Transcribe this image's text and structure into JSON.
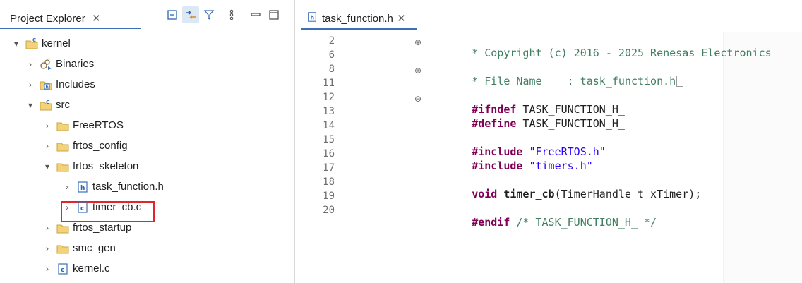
{
  "explorer": {
    "tab_label": "Project Explorer",
    "toolbar_icons": [
      "collapse-all-icon",
      "link-with-editor-icon",
      "filter-icon",
      "view-menu-icon",
      "minimize-icon",
      "maximize-icon"
    ],
    "tree": [
      {
        "label": "kernel",
        "icon": "c-project-icon",
        "expanded": true,
        "level": 0
      },
      {
        "label": "Binaries",
        "icon": "binaries-icon",
        "expanded": false,
        "level": 1
      },
      {
        "label": "Includes",
        "icon": "includes-icon",
        "expanded": false,
        "level": 1
      },
      {
        "label": "src",
        "icon": "source-folder-icon",
        "expanded": true,
        "level": 1
      },
      {
        "label": "FreeRTOS",
        "icon": "folder-icon",
        "expanded": false,
        "level": 2
      },
      {
        "label": "frtos_config",
        "icon": "folder-icon",
        "expanded": false,
        "level": 2
      },
      {
        "label": "frtos_skeleton",
        "icon": "folder-icon",
        "expanded": true,
        "level": 2
      },
      {
        "label": "task_function.h",
        "icon": "header-file-icon",
        "expanded": false,
        "level": 3
      },
      {
        "label": "timer_cb.c",
        "icon": "c-file-icon",
        "expanded": false,
        "level": 3,
        "highlighted": true
      },
      {
        "label": "frtos_startup",
        "icon": "folder-icon",
        "expanded": false,
        "level": 2
      },
      {
        "label": "smc_gen",
        "icon": "folder-icon",
        "expanded": false,
        "level": 2
      },
      {
        "label": "kernel.c",
        "icon": "c-file-icon",
        "expanded": false,
        "level": 2
      }
    ]
  },
  "editor": {
    "tab_label": "task_function.h",
    "line_numbers": [
      "2",
      "6",
      "8",
      "11",
      "12",
      "13",
      "14",
      "15",
      "16",
      "17",
      "18",
      "19",
      "20"
    ],
    "lines": {
      "copyright": "* Copyright (c) 2016 - 2025 Renesas Electronics",
      "filename_prefix": "* File Name    : task_function.h",
      "ifndef_kw": "#ifndef",
      "ifndef_rest": " TASK_FUNCTION_H_",
      "define_kw": "#define",
      "define_rest": " TASK_FUNCTION_H_",
      "include1_kw": "#include",
      "include1_str": " \"FreeRTOS.h\"",
      "include2_kw": "#include",
      "include2_str": " \"timers.h\"",
      "void_kw": "void",
      "func_name": " timer_cb",
      "func_args": "(TimerHandle_t xTimer);",
      "endif_kw": "#endif",
      "endif_comment": " /* TASK_FUNCTION_H_ */"
    }
  },
  "colors": {
    "accent": "#3b6fb6",
    "highlight_border": "#e0262a",
    "directive": "#7f0055",
    "comment": "#3f7f5f",
    "string": "#2a00ff"
  }
}
